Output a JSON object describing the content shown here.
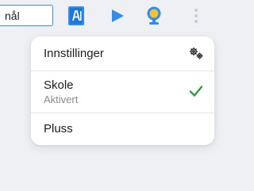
{
  "toolbar": {
    "search_value": "nål",
    "icons": [
      "dictionary-icon",
      "play-icon",
      "read-aloud-icon",
      "more-options-icon"
    ],
    "accent_color": "#2f8df0"
  },
  "menu": {
    "items": [
      {
        "label": "Innstillinger",
        "icon": "gears-icon"
      },
      {
        "label": "Skole",
        "sublabel": "Aktivert",
        "icon": "checkmark-icon",
        "check_color": "#2e9e3f"
      },
      {
        "label": "Pluss"
      }
    ]
  }
}
